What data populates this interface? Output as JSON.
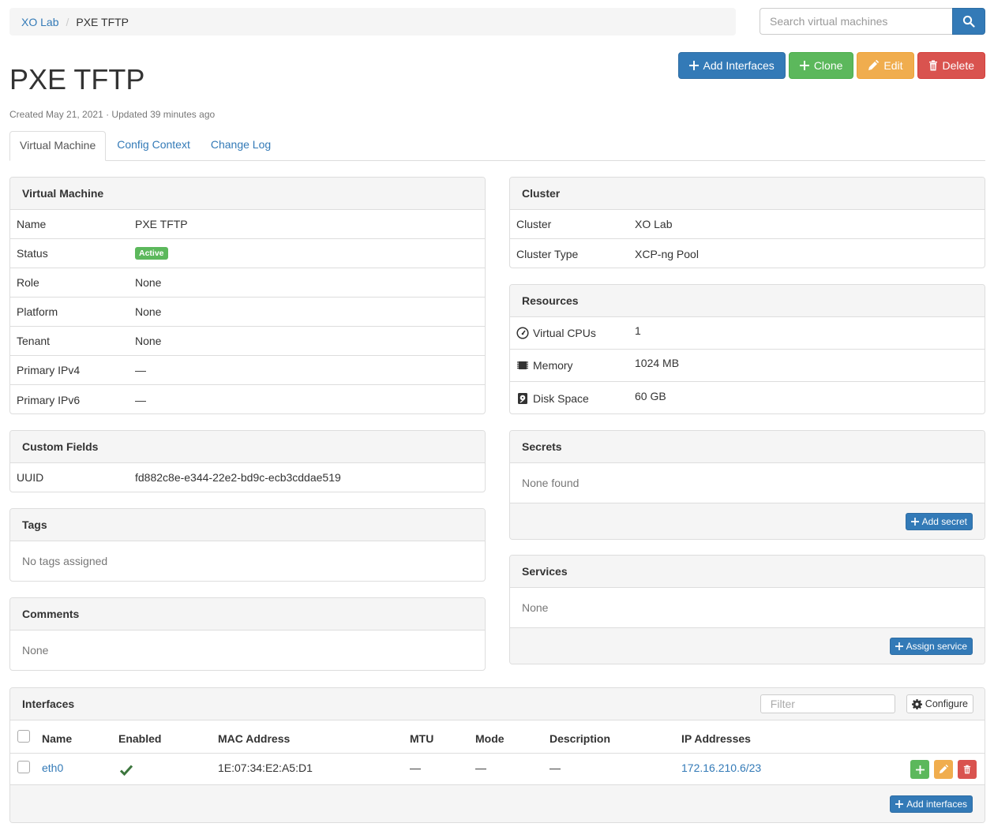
{
  "breadcrumb": {
    "parent": "XO Lab",
    "current": "PXE TFTP"
  },
  "search": {
    "placeholder": "Search virtual machines"
  },
  "actions": {
    "add_interfaces": "Add Interfaces",
    "clone": "Clone",
    "edit": "Edit",
    "delete": "Delete"
  },
  "page": {
    "title": "PXE TFTP",
    "meta": "Created May 21, 2021 · Updated 39 minutes ago"
  },
  "tabs": [
    {
      "label": "Virtual Machine",
      "active": true
    },
    {
      "label": "Config Context",
      "active": false
    },
    {
      "label": "Change Log",
      "active": false
    }
  ],
  "vm": {
    "heading": "Virtual Machine",
    "rows": [
      {
        "key": "Name",
        "value": "PXE TFTP"
      },
      {
        "key": "Status",
        "value": "Active"
      },
      {
        "key": "Role",
        "value": "None"
      },
      {
        "key": "Platform",
        "value": "None"
      },
      {
        "key": "Tenant",
        "value": "None"
      },
      {
        "key": "Primary IPv4",
        "value": "—"
      },
      {
        "key": "Primary IPv6",
        "value": "—"
      }
    ]
  },
  "custom_fields": {
    "heading": "Custom Fields",
    "key": "UUID",
    "value": "fd882c8e-e344-22e2-bd9c-ecb3cddae519"
  },
  "tags": {
    "heading": "Tags",
    "body": "No tags assigned"
  },
  "comments": {
    "heading": "Comments",
    "body": "None"
  },
  "cluster": {
    "heading": "Cluster",
    "rows": [
      {
        "key": "Cluster",
        "value": "XO Lab"
      },
      {
        "key": "Cluster Type",
        "value": "XCP-ng Pool"
      }
    ]
  },
  "resources": {
    "heading": "Resources",
    "rows": [
      {
        "key": "Virtual CPUs",
        "value": "1",
        "icon": "gauge-icon"
      },
      {
        "key": "Memory",
        "value": "1024 MB",
        "icon": "chip-icon"
      },
      {
        "key": "Disk Space",
        "value": "60 GB",
        "icon": "harddisk-icon"
      }
    ]
  },
  "secrets": {
    "heading": "Secrets",
    "body": "None found",
    "button": "Add secret"
  },
  "services": {
    "heading": "Services",
    "body": "None",
    "button": "Assign service"
  },
  "interfaces": {
    "heading": "Interfaces",
    "filter_placeholder": "Filter",
    "configure": "Configure",
    "columns": [
      "Name",
      "Enabled",
      "MAC Address",
      "MTU",
      "Mode",
      "Description",
      "IP Addresses"
    ],
    "rows": [
      {
        "name": "eth0",
        "enabled": true,
        "mac": "1E:07:34:E2:A5:D1",
        "mtu": "—",
        "mode": "—",
        "description": "—",
        "ip": "172.16.210.6/23"
      }
    ],
    "add_button": "Add interfaces"
  },
  "colors": {
    "primary": "#337ab7",
    "success": "#5cb85c",
    "warning": "#f0ad4e",
    "danger": "#d9534f"
  }
}
